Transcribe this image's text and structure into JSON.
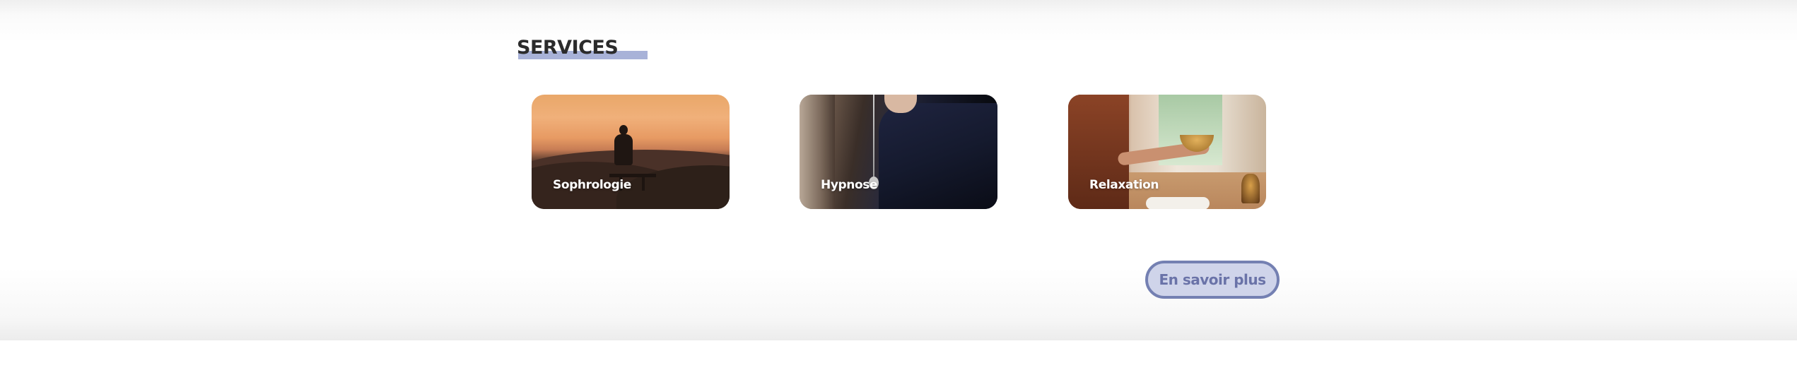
{
  "section": {
    "title": "SERVICES",
    "accent_color": "#a8b2d8"
  },
  "services": [
    {
      "label": "Sophrologie",
      "image": "sunset-meditation-photo"
    },
    {
      "label": "Hypnose",
      "image": "pendulum-photo"
    },
    {
      "label": "Relaxation",
      "image": "singing-bowl-photo"
    }
  ],
  "cta": {
    "label": "En savoir plus",
    "border_color": "#7480b2",
    "background": "#cfd4ea"
  }
}
